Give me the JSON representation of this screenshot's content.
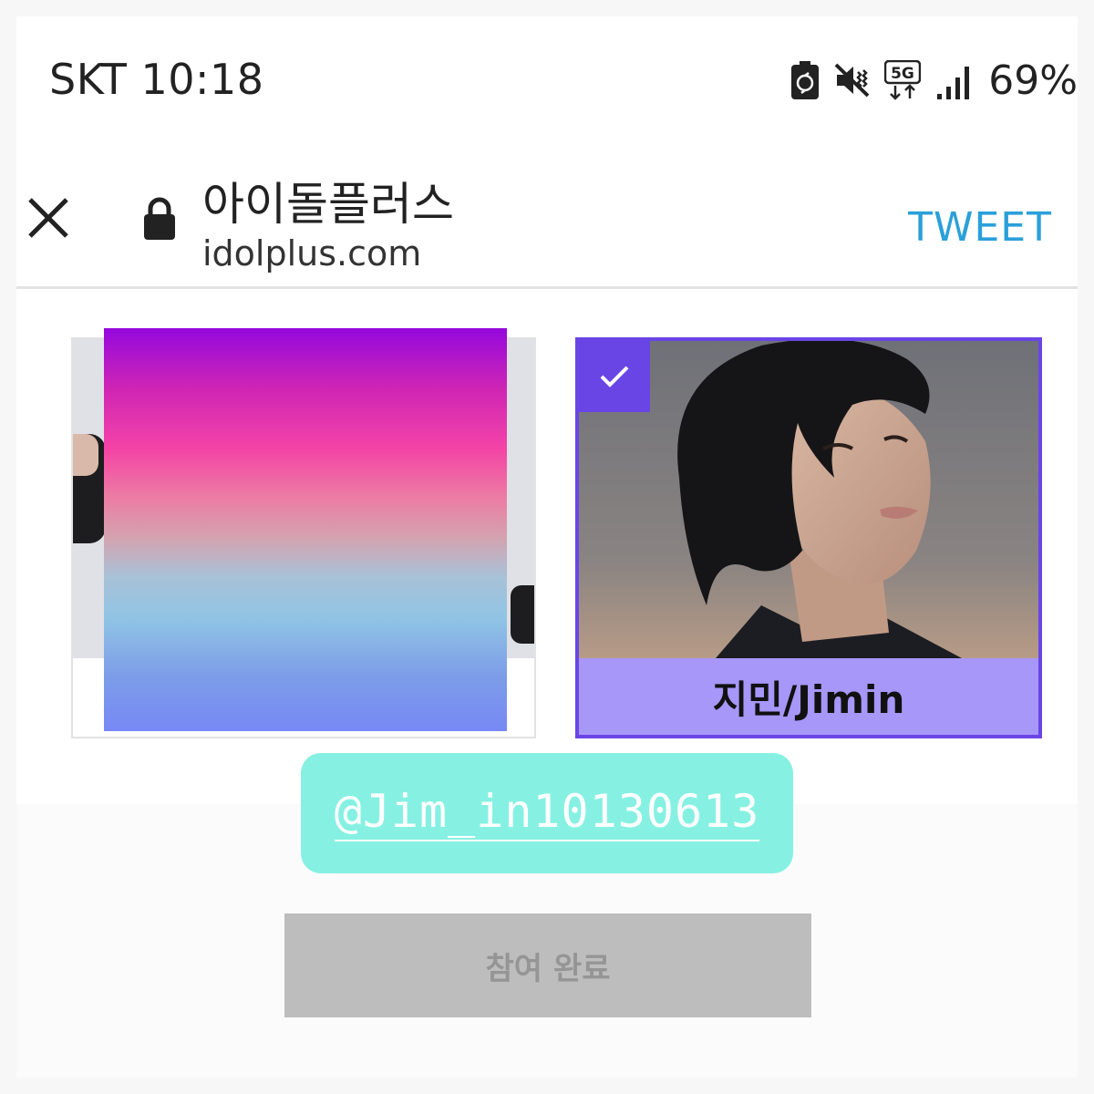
{
  "status_bar": {
    "carrier_time": "SKT 10:18",
    "battery_percent": "69%",
    "icons": [
      "battery-saver-icon",
      "vibrate-mute-icon",
      "5g-icon",
      "signal-icon"
    ]
  },
  "header": {
    "close_icon": "close-icon",
    "lock_icon": "lock-icon",
    "title": "아이돌플러스",
    "url": "idolplus.com",
    "tweet_label": "TWEET"
  },
  "cards": [
    {
      "name": "",
      "selected": false
    },
    {
      "name": "지민/Jimin",
      "selected": true
    }
  ],
  "handle_tag": {
    "text": "@Jim_in10130613"
  },
  "complete_button": {
    "label": "참여 완료"
  },
  "colors": {
    "accent": "#6a45e6",
    "card_label_bg": "#a797f9",
    "tweet_blue": "#2aa0da",
    "tag_bg": "#86f1e2",
    "button_disabled_bg": "#bdbdbd"
  }
}
